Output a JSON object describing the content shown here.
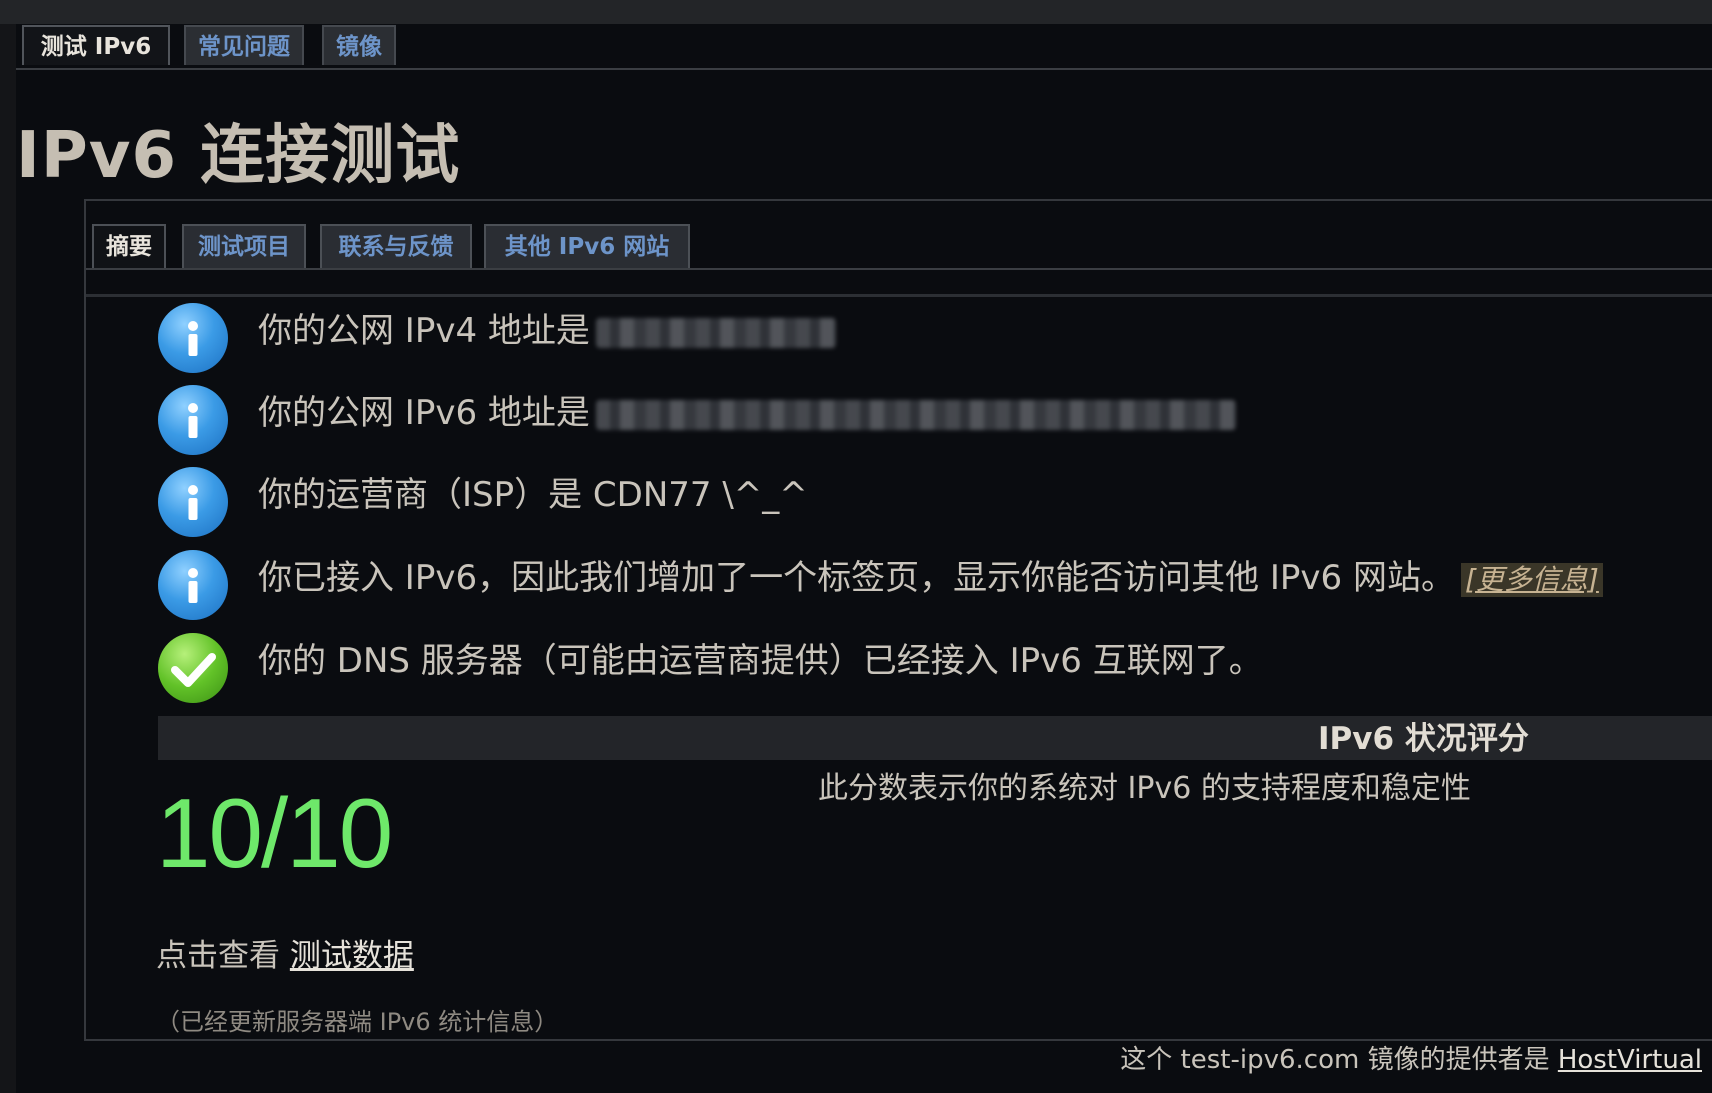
{
  "top_tabs": [
    "测试 IPv6",
    "常见问题",
    "镜像"
  ],
  "title": "IPv6 连接测试",
  "sub_tabs": [
    "摘要",
    "测试项目",
    "联系与反馈",
    "其他 IPv6 网站"
  ],
  "rows": [
    {
      "icon": "info-icon",
      "text": "你的公网 IPv4 地址是"
    },
    {
      "icon": "info-icon",
      "text": "你的公网 IPv6 地址是"
    },
    {
      "icon": "info-icon",
      "text": "你的运营商（ISP）是 CDN77 \\^_^"
    },
    {
      "icon": "info-icon",
      "text": "你已接入 IPv6，因此我们增加了一个标签页，显示你能否访问其他 IPv6 网站。",
      "link": "[更多信息]"
    },
    {
      "icon": "check-icon",
      "text": "你的 DNS 服务器（可能由运营商提供）已经接入 IPv6 互联网了。"
    }
  ],
  "score": {
    "heading": "IPv6 状况评分",
    "description": "此分数表示你的系统对 IPv6 的支持程度和稳定性",
    "value": "10/10"
  },
  "click_view": {
    "prefix": "点击查看",
    "link": "测试数据"
  },
  "stats_note": "（已经更新服务器端 IPv6 统计信息）",
  "footer": {
    "prefix": "这个 test-ipv6.com 镜像的提供者是",
    "link": "HostVirtual"
  },
  "colors": {
    "accent_tab": "#6d94c9",
    "score_green": "#6ee86a",
    "link_gold": "#c7b392"
  }
}
